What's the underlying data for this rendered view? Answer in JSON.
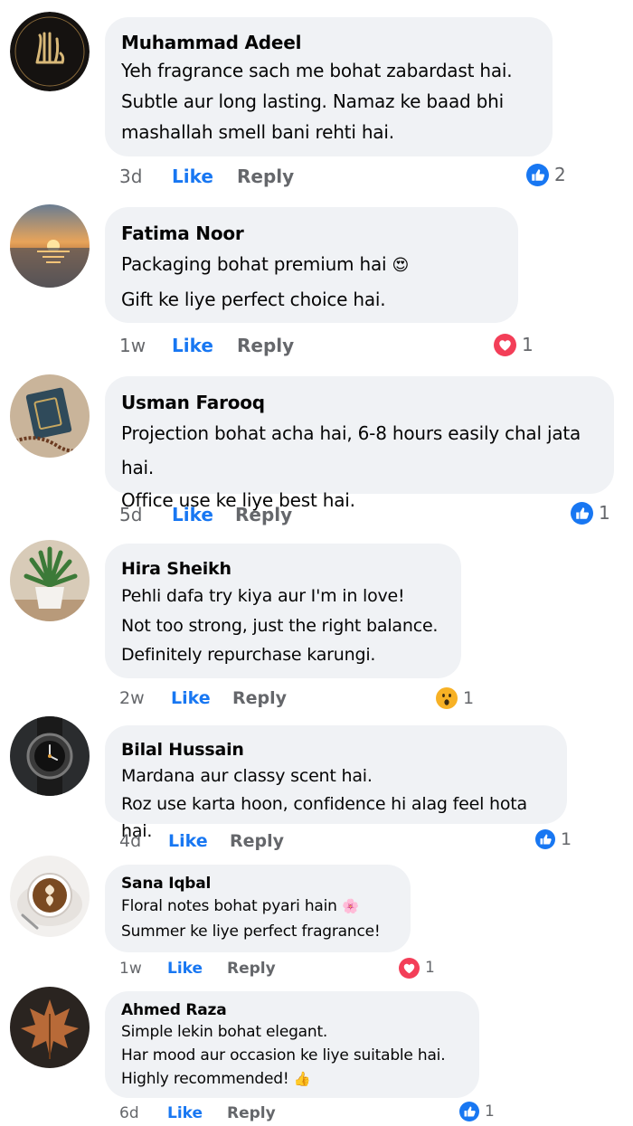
{
  "comments": [
    {
      "author": "Muhammad Adeel",
      "lines": [
        "Yeh fragrance sach me bohat zabardast hai.",
        "Subtle aur long lasting. Namaz ke baad bhi",
        "mashallah smell bani rehti hai."
      ],
      "time": "3d",
      "like": "Like",
      "reply": "Reply",
      "reaction": "like",
      "reaction_count": "2",
      "avatar": "allah-calligraphy"
    },
    {
      "author": "Fatima Noor",
      "lines": [
        "Packaging bohat premium hai",
        "Gift ke liye perfect choice hai."
      ],
      "emoji": "😍",
      "time": "1w",
      "like": "Like",
      "reply": "Reply",
      "reaction": "love",
      "reaction_count": "1",
      "avatar": "sunset-sea"
    },
    {
      "author": "Usman Farooq",
      "lines": [
        "Projection bohat acha hai, 6-8 hours easily chal jata hai.",
        "Office use ke liye best hai."
      ],
      "time": "5d",
      "like": "Like",
      "reply": "Reply",
      "reaction": "like",
      "reaction_count": "1",
      "avatar": "quran-book"
    },
    {
      "author": "Hira Sheikh",
      "lines": [
        "Pehli dafa try kiya aur I'm in love!",
        "Not too strong, just the right balance.",
        "Definitely repurchase karungi."
      ],
      "time": "2w",
      "like": "Like",
      "reply": "Reply",
      "reaction": "wow",
      "reaction_count": "1",
      "avatar": "potted-plant"
    },
    {
      "author": "Bilal Hussain",
      "lines": [
        "Mardana aur classy scent hai.",
        "Roz use karta hoon, confidence hi alag feel hota hai."
      ],
      "time": "4d",
      "like": "Like",
      "reply": "Reply",
      "reaction": "like",
      "reaction_count": "1",
      "avatar": "wrist-watch"
    },
    {
      "author": "Sana Iqbal",
      "lines": [
        "Floral notes bohat pyari hain",
        "Summer ke liye perfect fragrance!"
      ],
      "emoji": "🌸",
      "time": "1w",
      "like": "Like",
      "reply": "Reply",
      "reaction": "love",
      "reaction_count": "1",
      "avatar": "coffee-cup"
    },
    {
      "author": "Ahmed Raza",
      "lines": [
        "Simple lekin bohat elegant.",
        "Har mood aur occasion ke liye suitable hai.",
        "Highly recommended!"
      ],
      "emoji": "👍",
      "time": "6d",
      "like": "Like",
      "reply": "Reply",
      "reaction": "like",
      "reaction_count": "1",
      "avatar": "maple-leaf"
    }
  ],
  "colors": {
    "like_blue": "#1877f2",
    "love_red": "#f33e58",
    "wow_yellow": "#f7b125",
    "bubble": "#f0f2f5",
    "meta_gray": "#65676b"
  }
}
